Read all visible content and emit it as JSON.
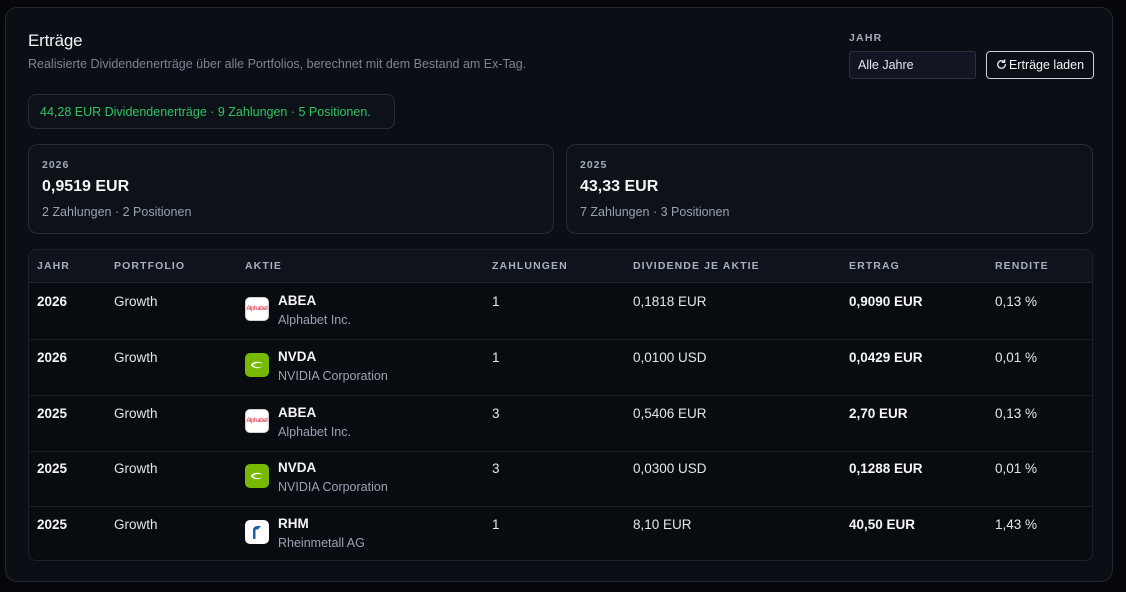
{
  "header": {
    "title": "Erträge",
    "subtitle": "Realisierte Dividendenerträge über alle Portfolios, berechnet mit dem Bestand am Ex-Tag."
  },
  "filter": {
    "year_label": "JAHR",
    "year_selected": "Alle Jahre",
    "load_button": "Erträge laden",
    "load_icon": "refresh-icon"
  },
  "summary": "44,28 EUR Dividendenerträge · 9 Zahlungen · 5 Positionen.",
  "colors": {
    "summary_text": "#2fc463",
    "nvidia": "#76b900",
    "alphabet": "#dd1122"
  },
  "year_cards": [
    {
      "year": "2026",
      "amount": "0,9519 EUR",
      "stats": "2 Zahlungen · 2 Positionen"
    },
    {
      "year": "2025",
      "amount": "43,33 EUR",
      "stats": "7 Zahlungen · 3 Positionen"
    }
  ],
  "table": {
    "columns": [
      "JAHR",
      "PORTFOLIO",
      "AKTIE",
      "ZAHLUNGEN",
      "DIVIDENDE JE AKTIE",
      "ERTRAG",
      "RENDITE"
    ],
    "rows": [
      {
        "year": "2026",
        "portfolio": "Growth",
        "ticker": "ABEA",
        "company": "Alphabet Inc.",
        "logo": "alphabet-logo",
        "logo_text": "Alphabet",
        "payments": "1",
        "dps": "0,1818 EUR",
        "income": "0,9090 EUR",
        "yield": "0,13 %"
      },
      {
        "year": "2026",
        "portfolio": "Growth",
        "ticker": "NVDA",
        "company": "NVIDIA Corporation",
        "logo": "nvidia-logo",
        "payments": "1",
        "dps": "0,0100 USD",
        "income": "0,0429 EUR",
        "yield": "0,01 %"
      },
      {
        "year": "2025",
        "portfolio": "Growth",
        "ticker": "ABEA",
        "company": "Alphabet Inc.",
        "logo": "alphabet-logo",
        "logo_text": "Alphabet",
        "payments": "3",
        "dps": "0,5406 EUR",
        "income": "2,70 EUR",
        "yield": "0,13 %"
      },
      {
        "year": "2025",
        "portfolio": "Growth",
        "ticker": "NVDA",
        "company": "NVIDIA Corporation",
        "logo": "nvidia-logo",
        "payments": "3",
        "dps": "0,0300 USD",
        "income": "0,1288 EUR",
        "yield": "0,01 %"
      },
      {
        "year": "2025",
        "portfolio": "Growth",
        "ticker": "RHM",
        "company": "Rheinmetall AG",
        "logo": "rheinmetall-logo",
        "payments": "1",
        "dps": "8,10 EUR",
        "income": "40,50 EUR",
        "yield": "1,43 %"
      }
    ]
  }
}
